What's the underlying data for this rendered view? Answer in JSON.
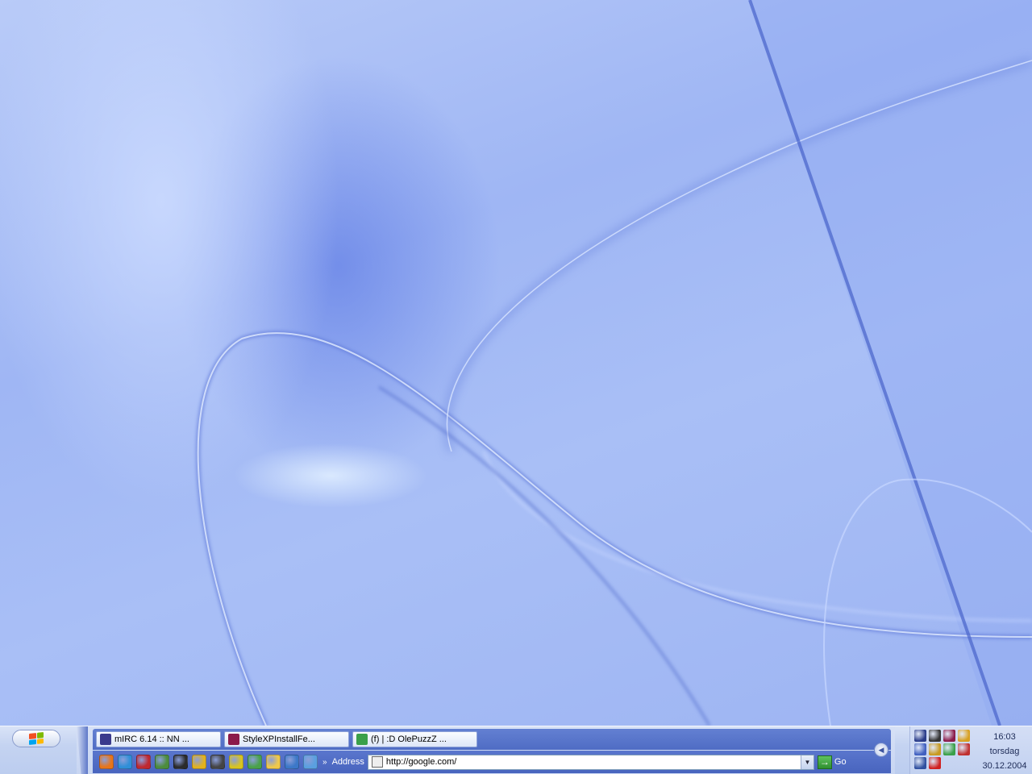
{
  "taskbar": {
    "start_icon": "windows-logo-icon",
    "windows_logo_colors": [
      "#f25022",
      "#7fba00",
      "#00a4ef",
      "#ffb900"
    ],
    "tasks": [
      {
        "label": "mIRC 6.14 :: NN ...",
        "icon": "mirc-icon",
        "icon_color": "#3a3a8c"
      },
      {
        "label": "StyleXPInstallFe...",
        "icon": "winrar-icon",
        "icon_color": "#8b1a4a"
      },
      {
        "label": "(f) | :D OlePuzzZ ...",
        "icon": "messenger-icon",
        "icon_color": "#3aa04a"
      }
    ],
    "quick_launch": [
      {
        "name": "firefox-icon",
        "color": "#e8751a"
      },
      {
        "name": "internet-explorer-icon",
        "color": "#2f8fd8"
      },
      {
        "name": "app-icon",
        "color": "#c0282f"
      },
      {
        "name": "winamp-icon",
        "color": "#4c8c3c"
      },
      {
        "name": "steam-icon",
        "color": "#2b2b2b"
      },
      {
        "name": "pencil-icon",
        "color": "#e2b21e"
      },
      {
        "name": "helmet-icon",
        "color": "#444444"
      },
      {
        "name": "cd-icon",
        "color": "#d8c420"
      },
      {
        "name": "people-icon",
        "color": "#4aa24a"
      },
      {
        "name": "folder-icon",
        "color": "#efc84a"
      },
      {
        "name": "window-icon",
        "color": "#3c78c8"
      },
      {
        "name": "ie-page-icon",
        "color": "#5aa0e0"
      }
    ],
    "more_chevron": "»",
    "address": {
      "label": "Address",
      "value": "http://google.com/",
      "go_label": "Go",
      "dropdown_arrow": "▼",
      "go_arrow": "→"
    },
    "collapse_arrow": "◀"
  },
  "tray": {
    "icons": [
      {
        "name": "music-note-icon",
        "color": "#2a3c8a"
      },
      {
        "name": "network-icon",
        "color": "#333333"
      },
      {
        "name": "winrar-tray-icon",
        "color": "#8b1a4a"
      },
      {
        "name": "compass-icon",
        "color": "#d8a020"
      },
      {
        "name": "sync-icon",
        "color": "#4060c0"
      },
      {
        "name": "notepad-icon",
        "color": "#c89a20"
      },
      {
        "name": "messenger-tray-icon",
        "color": "#3aa04a"
      },
      {
        "name": "antivirus-icon",
        "color": "#c03030"
      },
      {
        "name": "volume-icon",
        "color": "#3050a0"
      },
      {
        "name": "ati-icon",
        "color": "#d02020"
      }
    ],
    "clock": {
      "time": "16:03",
      "day": "torsdag",
      "date": "30.12.2004"
    }
  }
}
